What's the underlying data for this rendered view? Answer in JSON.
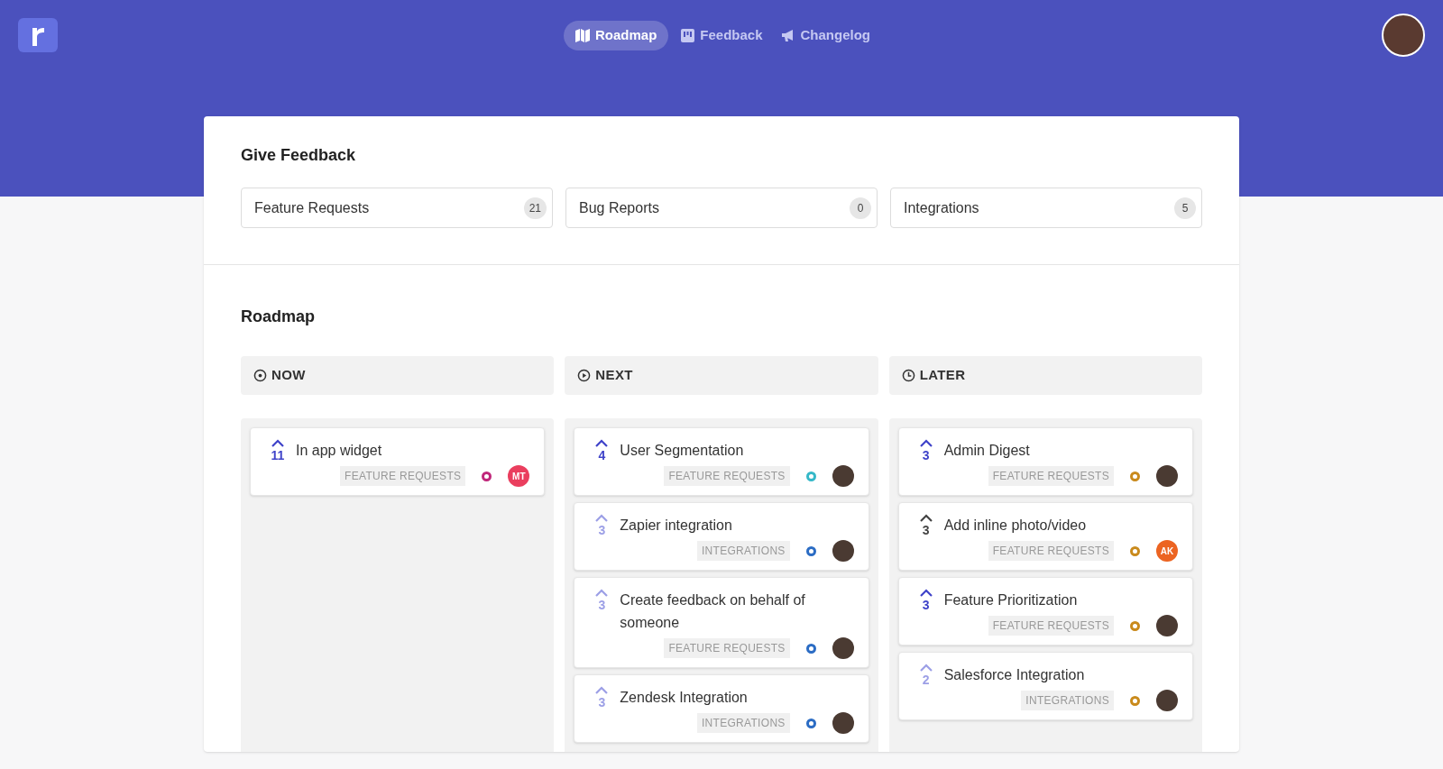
{
  "nav": {
    "items": [
      {
        "label": "Roadmap",
        "selected": true
      },
      {
        "label": "Feedback",
        "selected": false
      },
      {
        "label": "Changelog",
        "selected": false
      }
    ]
  },
  "give_feedback": {
    "title": "Give Feedback",
    "boards": [
      {
        "label": "Feature Requests",
        "count": "21"
      },
      {
        "label": "Bug Reports",
        "count": "0"
      },
      {
        "label": "Integrations",
        "count": "5"
      }
    ]
  },
  "roadmap": {
    "title": "Roadmap",
    "columns": [
      {
        "label": "NOW",
        "cards": [
          {
            "title": "In app widget",
            "votes": "11",
            "kind": "voted",
            "tag": "FEATURE REQUESTS",
            "color": "#c0267a",
            "avatar": {
              "kind": "initials",
              "initials": "MT",
              "color": "#ea3e5e"
            }
          }
        ]
      },
      {
        "label": "NEXT",
        "cards": [
          {
            "title": "User Segmentation",
            "votes": "4",
            "kind": "voted",
            "tag": "FEATURE REQUESTS",
            "color": "#35b8c8",
            "avatar": {
              "kind": "photo"
            }
          },
          {
            "title": "Zapier integration",
            "votes": "3",
            "kind": "unvoted",
            "tag": "INTEGRATIONS",
            "color": "#2b6cc4",
            "avatar": {
              "kind": "photo"
            }
          },
          {
            "title": "Create feedback on behalf of someone",
            "votes": "3",
            "kind": "unvoted",
            "tag": "FEATURE REQUESTS",
            "color": "#2b6cc4",
            "avatar": {
              "kind": "photo"
            }
          },
          {
            "title": "Zendesk Integration",
            "votes": "3",
            "kind": "unvoted",
            "tag": "INTEGRATIONS",
            "color": "#2b6cc4",
            "avatar": {
              "kind": "photo"
            }
          }
        ]
      },
      {
        "label": "LATER",
        "cards": [
          {
            "title": "Admin Digest",
            "votes": "3",
            "kind": "voted",
            "tag": "FEATURE REQUESTS",
            "color": "#c98a1c",
            "avatar": {
              "kind": "photo"
            }
          },
          {
            "title": "Add inline photo/video",
            "votes": "3",
            "kind": "own",
            "tag": "FEATURE REQUESTS",
            "color": "#c98a1c",
            "avatar": {
              "kind": "initials",
              "initials": "AK",
              "color": "#ec6422"
            }
          },
          {
            "title": "Feature Prioritization",
            "votes": "3",
            "kind": "voted",
            "tag": "FEATURE REQUESTS",
            "color": "#c98a1c",
            "avatar": {
              "kind": "photo"
            }
          },
          {
            "title": "Salesforce Integration",
            "votes": "2",
            "kind": "unvoted",
            "tag": "INTEGRATIONS",
            "color": "#c98a1c",
            "avatar": {
              "kind": "photo"
            }
          }
        ]
      }
    ]
  }
}
